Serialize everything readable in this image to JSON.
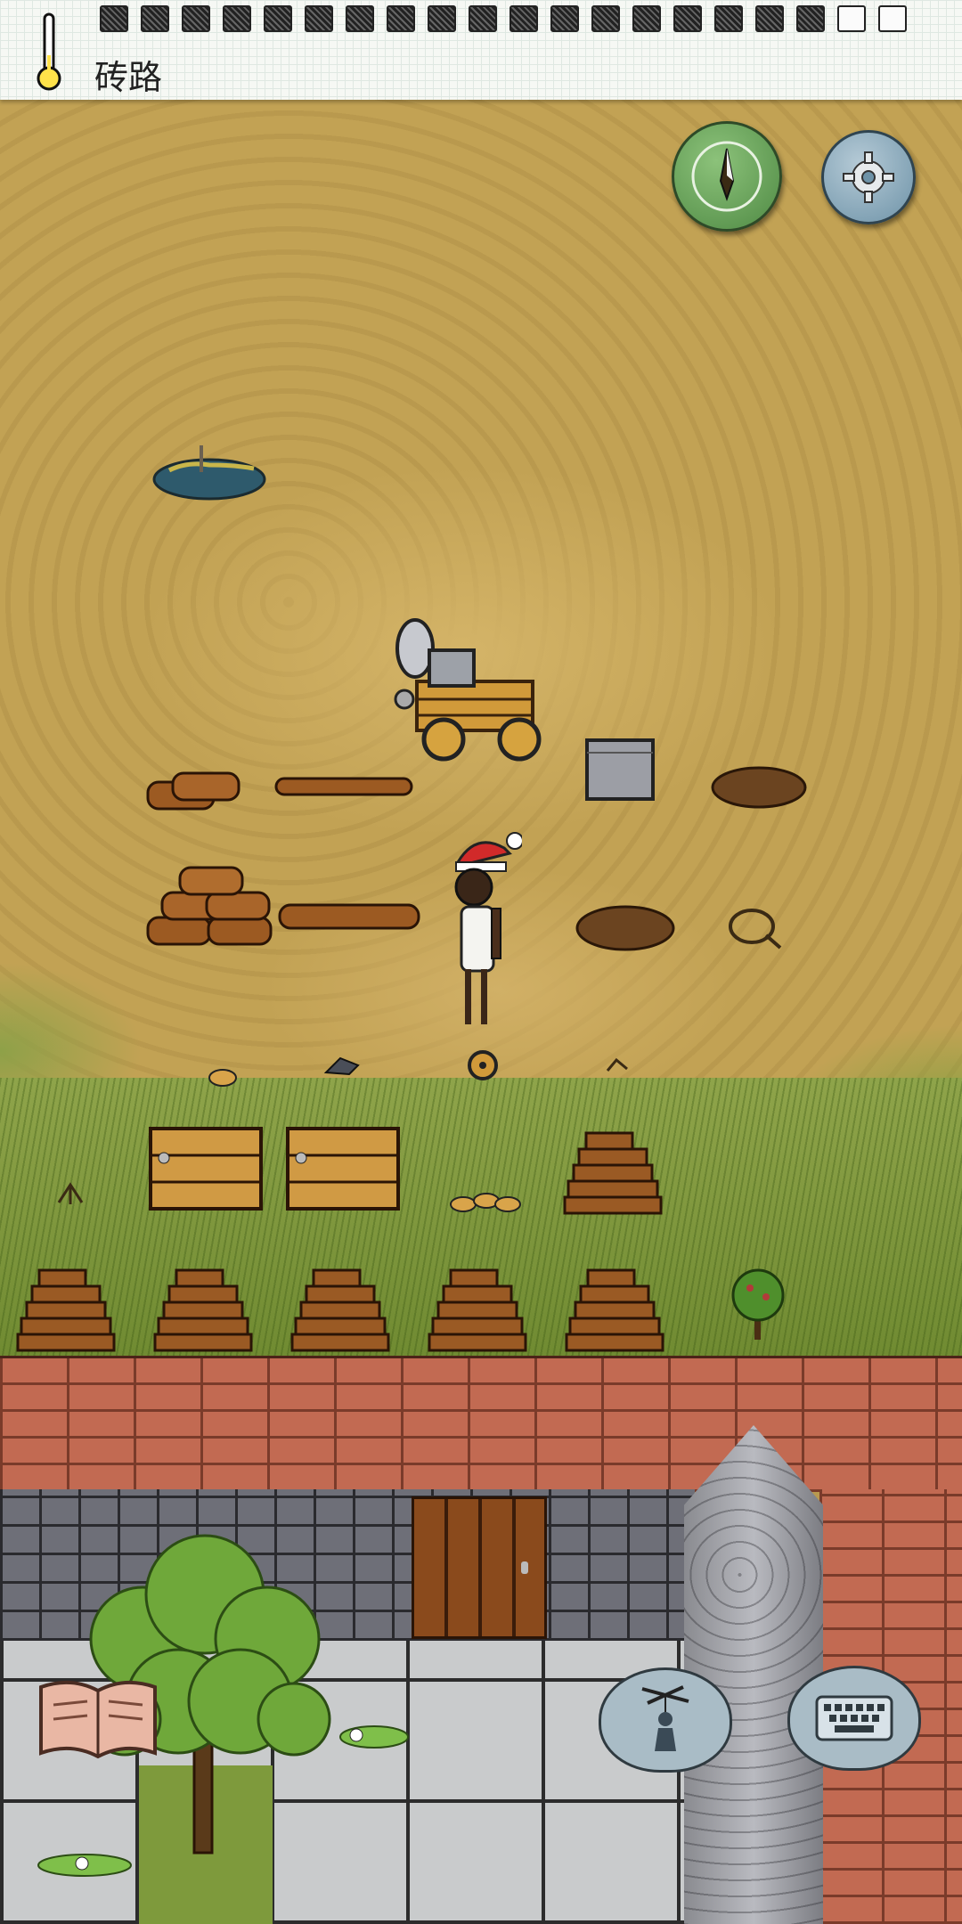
{
  "hud": {
    "location_label": "砖路",
    "food_pips": {
      "filled": 18,
      "empty": 2
    },
    "temperature_icon": "thermometer-icon"
  },
  "buttons": {
    "compass_icon": "compass-icon",
    "settings_icon": "gear-icon",
    "tech_book_icon": "open-book-icon",
    "emote_icon": "puppet-emote-icon",
    "chat_icon": "keyboard-icon"
  },
  "colors": {
    "compass_green": "#5f9b52",
    "settings_blue": "#7fa1b4",
    "dirt": "#c2a254",
    "grass": "#7e9a3c",
    "brick": "#c26a52"
  },
  "objects": [
    "pond",
    "bandsaw-cart",
    "stone-block",
    "log-pile",
    "single-log",
    "log-pyramid",
    "long-log",
    "kindling-pile",
    "rope-coil",
    "wooden-crate",
    "board-stack",
    "sapling",
    "tree",
    "player-with-santa-hat"
  ]
}
